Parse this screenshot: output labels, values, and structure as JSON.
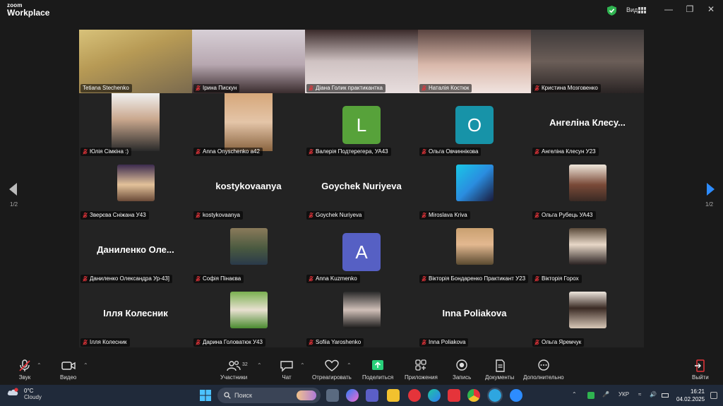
{
  "app": {
    "logo_line1": "zoom",
    "logo_line2": "Workplace",
    "view_label": "Вид"
  },
  "colors": {
    "active": "#28d07a",
    "accent": "#2d8cff",
    "mic_off": "#e5343a"
  },
  "pagination": {
    "left": "1/2",
    "right": "1/2"
  },
  "participants": [
    {
      "label": "Tetiana Stechenko",
      "kind": "photo",
      "muted": false,
      "active": true
    },
    {
      "label": "Ірина Пискун",
      "kind": "photo",
      "muted": true
    },
    {
      "label": "Діана Голик практикантка",
      "kind": "photo",
      "muted": true
    },
    {
      "label": "Наталія Костюк",
      "kind": "photo",
      "muted": true
    },
    {
      "label": "Кристина Мозговенко",
      "kind": "photo",
      "muted": true
    },
    {
      "label": "Юлія Сімкіна :)",
      "kind": "photo",
      "muted": true
    },
    {
      "label": "Anna Onyschenko a42",
      "kind": "photo",
      "muted": true
    },
    {
      "label": "Валерія Подтерегера, УА43",
      "kind": "letter",
      "letter": "L",
      "bg": "#57a23a",
      "muted": true
    },
    {
      "label": "Ольга Овчиннікова",
      "kind": "letter",
      "letter": "O",
      "bg": "#1793a8",
      "muted": true
    },
    {
      "label": "Ангеліна Клесун У23",
      "kind": "name",
      "display": "Ангеліна Клесу...",
      "muted": true
    },
    {
      "label": "Зверєва Сніжана У43",
      "kind": "photo",
      "muted": true
    },
    {
      "label": "kostykovaanya",
      "kind": "name",
      "display": "kostykovaanya",
      "muted": true
    },
    {
      "label": "Goychek Nuriyeva",
      "kind": "name",
      "display": "Goychek Nuriyeva",
      "muted": true
    },
    {
      "label": "Miroslava Kriva",
      "kind": "photo",
      "muted": true
    },
    {
      "label": "Ольга Рубець УА43",
      "kind": "photo",
      "muted": true
    },
    {
      "label": "Даниленко Олександра Ур-43]",
      "kind": "name",
      "display": "Даниленко Оле...",
      "muted": true
    },
    {
      "label": "Софія Пінаєва",
      "kind": "photo",
      "muted": true
    },
    {
      "label": "Anna Kuzmenko",
      "kind": "letter",
      "letter": "A",
      "bg": "#5660c4",
      "muted": true
    },
    {
      "label": "Вікторія Бондаренко Практикант У23",
      "kind": "photo",
      "muted": true
    },
    {
      "label": "Вікторія Горох",
      "kind": "photo",
      "muted": true
    },
    {
      "label": "Ілля Колесник",
      "kind": "name",
      "display": "Ілля Колесник",
      "muted": true
    },
    {
      "label": "Дарина Головатюк У43",
      "kind": "photo",
      "muted": true
    },
    {
      "label": "Sofiia Yaroshenko",
      "kind": "photo",
      "muted": true
    },
    {
      "label": "Inna Poliakova",
      "kind": "name",
      "display": "Inna Poliakova",
      "muted": true
    },
    {
      "label": "Ольга Яремчук",
      "kind": "photo",
      "muted": true
    }
  ],
  "toolbar": {
    "audio": "Звук",
    "video": "Видео",
    "participants": "Участники",
    "participants_count": "32",
    "chat": "Чат",
    "react": "Отреагировать",
    "share": "Поделиться",
    "apps": "Приложения",
    "record": "Запись",
    "docs": "Документы",
    "more": "Дополнительно",
    "leave": "Выйти"
  },
  "taskbar": {
    "temp": "0°C",
    "weather": "Cloudy",
    "search": "Поиск",
    "lang": "УКР",
    "time": "16:21",
    "date": "04.02.2025"
  }
}
